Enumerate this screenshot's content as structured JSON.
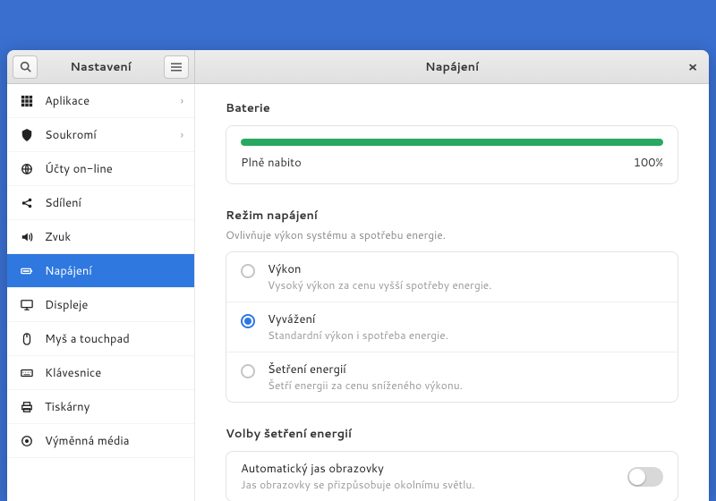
{
  "header": {
    "left_title": "Nastavení",
    "right_title": "Napájení"
  },
  "sidebar": {
    "items": [
      {
        "label": "Aplikace",
        "has_chevron": true
      },
      {
        "label": "Soukromí",
        "has_chevron": true
      },
      {
        "label": "Účty on-line",
        "has_chevron": false
      },
      {
        "label": "Sdílení",
        "has_chevron": false
      },
      {
        "label": "Zvuk",
        "has_chevron": false
      },
      {
        "label": "Napájení",
        "has_chevron": false
      },
      {
        "label": "Displeje",
        "has_chevron": false
      },
      {
        "label": "Myš a touchpad",
        "has_chevron": false
      },
      {
        "label": "Klávesnice",
        "has_chevron": false
      },
      {
        "label": "Tiskárny",
        "has_chevron": false
      },
      {
        "label": "Výměnná média",
        "has_chevron": false
      }
    ],
    "active_index": 5
  },
  "content": {
    "battery": {
      "section_title": "Baterie",
      "status": "Plně nabito",
      "percent": "100%"
    },
    "power_mode": {
      "section_title": "Režim napájení",
      "section_subtitle": "Ovlivňuje výkon systému a spotřebu energie.",
      "options": [
        {
          "title": "Výkon",
          "desc": "Vysoký výkon za cenu vyšší spotřeby energie."
        },
        {
          "title": "Vyvážení",
          "desc": "Standardní výkon i spotřeba energie."
        },
        {
          "title": "Šetření energií",
          "desc": "Šetří energii za cenu sníženého výkonu."
        }
      ],
      "selected_index": 1
    },
    "power_saving": {
      "section_title": "Volby šetření energií",
      "auto_brightness": {
        "title": "Automatický jas obrazovky",
        "desc": "Jas obrazovky se přizpůsobuje okolnímu světlu."
      }
    }
  }
}
